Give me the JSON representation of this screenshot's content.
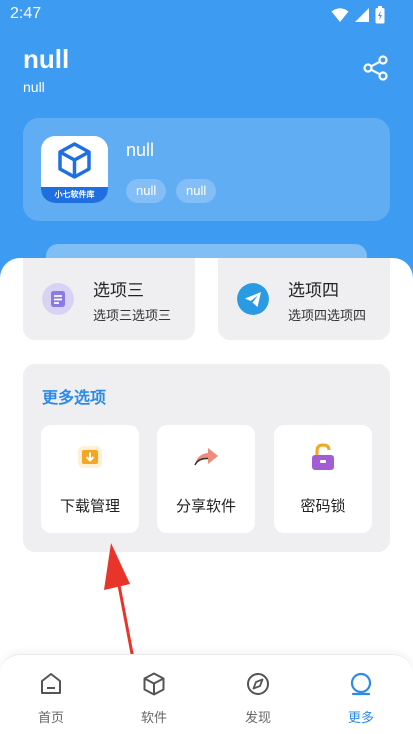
{
  "status_bar": {
    "time": "2:47"
  },
  "header": {
    "title": "null",
    "subtitle": "null"
  },
  "app_card": {
    "logo_text": "小七软件库",
    "name": "null",
    "tags": [
      "null",
      "null"
    ]
  },
  "options": [
    {
      "title": "选项三",
      "subtitle": "选项三选项三",
      "icon": "notebook-icon"
    },
    {
      "title": "选项四",
      "subtitle": "选项四选项四",
      "icon": "paper-plane-icon"
    }
  ],
  "more": {
    "title": "更多选项",
    "tools": [
      {
        "label": "下载管理",
        "icon": "download-folder-icon"
      },
      {
        "label": "分享软件",
        "icon": "share-arrow-icon"
      },
      {
        "label": "密码锁",
        "icon": "unlocked-padlock-icon"
      }
    ]
  },
  "nav": {
    "items": [
      {
        "label": "首页",
        "icon": "home-icon",
        "active": false
      },
      {
        "label": "软件",
        "icon": "cube-icon",
        "active": false
      },
      {
        "label": "发现",
        "icon": "compass-icon",
        "active": false
      },
      {
        "label": "更多",
        "icon": "more-icon",
        "active": true
      }
    ]
  },
  "colors": {
    "primary": "#3d9bf2",
    "accent": "#2d8ae8",
    "annotation_arrow": "#e8342a"
  }
}
